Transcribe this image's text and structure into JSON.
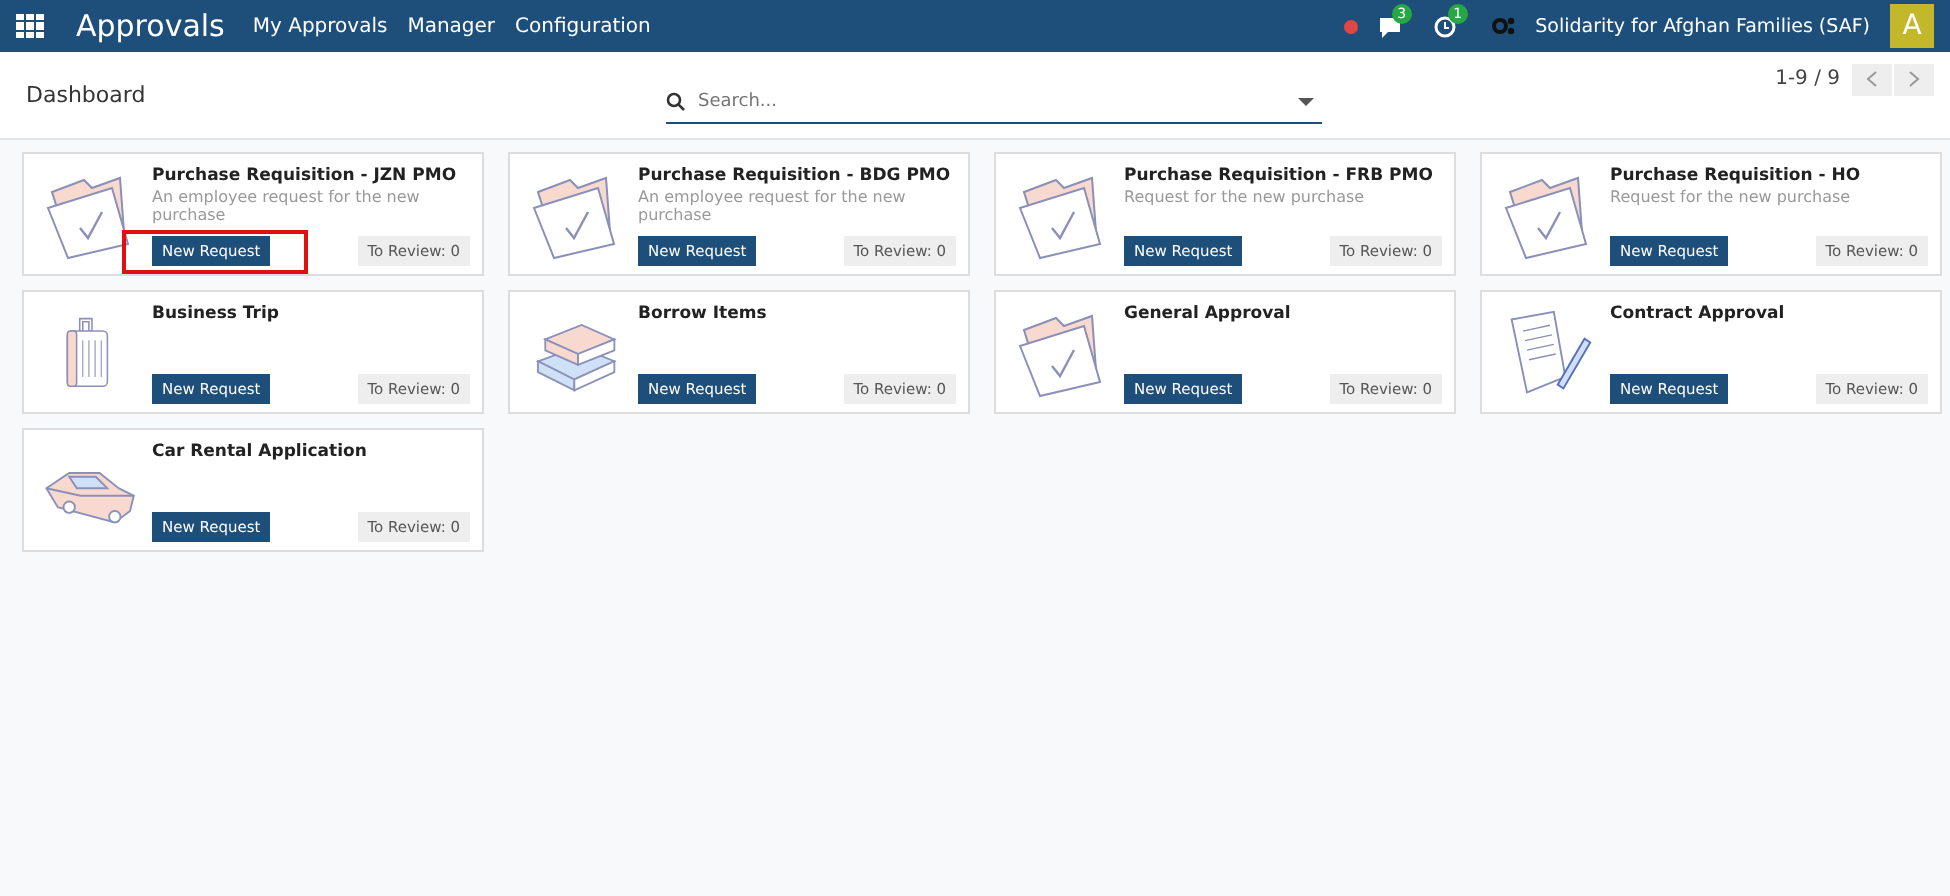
{
  "navbar": {
    "app_title": "Approvals",
    "menu": [
      "My Approvals",
      "Manager",
      "Configuration"
    ],
    "messages_count": "3",
    "activities_count": "1",
    "company": "Solidarity for Afghan Families (SAF)",
    "avatar_letter": "A"
  },
  "control_panel": {
    "breadcrumb": "Dashboard",
    "search": {
      "placeholder": "Search..."
    },
    "pager": "1-9 / 9"
  },
  "cards": [
    {
      "kind": "folder",
      "title": "Purchase Requisition - JZN PMO",
      "description": "An employee request for the new purchase",
      "new_button": "New Request",
      "review_button": "To Review: 0",
      "highlighted": true
    },
    {
      "kind": "folder",
      "title": "Purchase Requisition - BDG PMO",
      "description": "An employee request for the new purchase",
      "new_button": "New Request",
      "review_button": "To Review: 0",
      "highlighted": false
    },
    {
      "kind": "folder",
      "title": "Purchase Requisition - FRB PMO",
      "description": "Request for the new purchase",
      "new_button": "New Request",
      "review_button": "To Review: 0",
      "highlighted": false
    },
    {
      "kind": "folder",
      "title": "Purchase Requisition - HO",
      "description": "Request for the new purchase",
      "new_button": "New Request",
      "review_button": "To Review: 0",
      "highlighted": false
    },
    {
      "kind": "suitcase",
      "title": "Business Trip",
      "new_button": "New Request",
      "review_button": "To Review: 0",
      "highlighted": false
    },
    {
      "kind": "books",
      "title": "Borrow Items",
      "new_button": "New Request",
      "review_button": "To Review: 0",
      "highlighted": false
    },
    {
      "kind": "folder",
      "title": "General Approval",
      "new_button": "New Request",
      "review_button": "To Review: 0",
      "highlighted": false
    },
    {
      "kind": "contract",
      "title": "Contract Approval",
      "new_button": "New Request",
      "review_button": "To Review: 0",
      "highlighted": false
    },
    {
      "kind": "car",
      "title": "Car Rental Application",
      "new_button": "New Request",
      "review_button": "To Review: 0",
      "highlighted": false
    }
  ]
}
